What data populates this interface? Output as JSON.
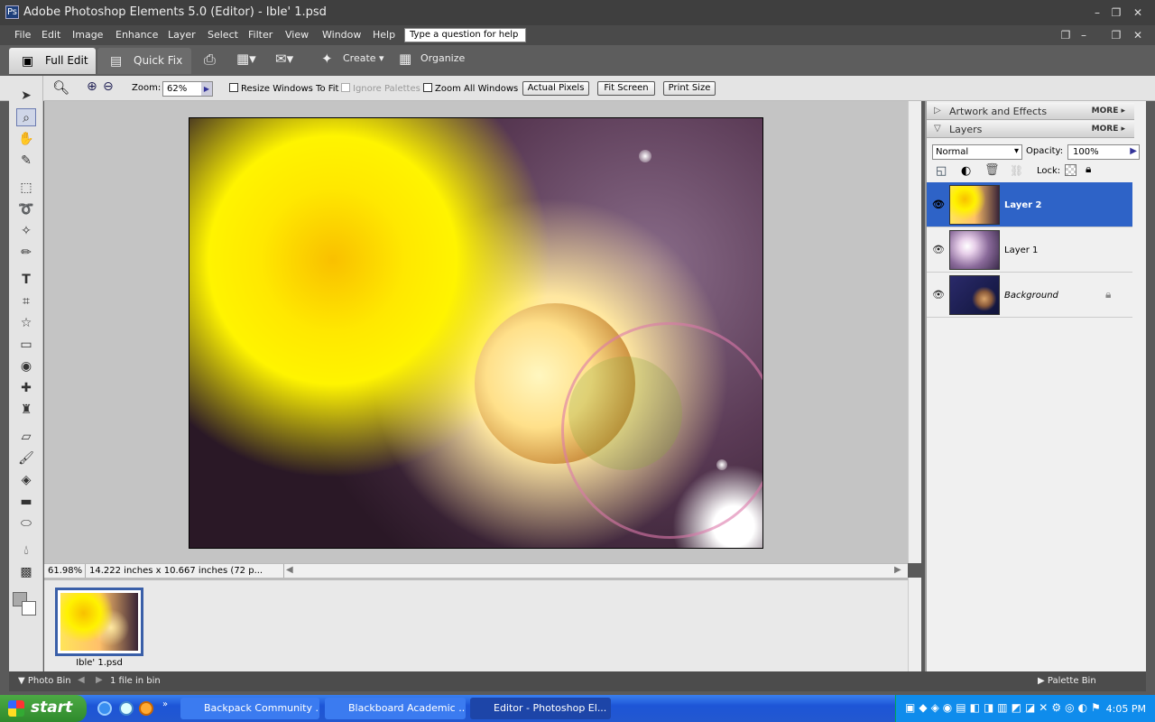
{
  "window": {
    "title": "Adobe Photoshop Elements 5.0 (Editor) - Ible' 1.psd"
  },
  "menu": {
    "items": [
      "File",
      "Edit",
      "Image",
      "Enhance",
      "Layer",
      "Select",
      "Filter",
      "View",
      "Window",
      "Help"
    ],
    "help_placeholder": "Type a question for help"
  },
  "modes": {
    "full_edit": "Full Edit",
    "quick_fix": "Quick Fix",
    "create": "Create",
    "organize": "Organize"
  },
  "options": {
    "zoom_label": "Zoom:",
    "zoom_value": "62%",
    "resize_windows": "Resize Windows To Fit",
    "ignore_palettes": "Ignore Palettes",
    "zoom_all": "Zoom All Windows",
    "actual_pixels": "Actual Pixels",
    "fit_screen": "Fit Screen",
    "print_size": "Print Size"
  },
  "status": {
    "zoom_pct": "61.98%",
    "doc_size": "14.222 inches x 10.667 inches (72 p..."
  },
  "photo_bin": {
    "thumb_label": "Ible' 1.psd",
    "label": "Photo Bin",
    "count": "1 file in bin"
  },
  "palette_bin": {
    "label": "Palette Bin"
  },
  "palette": {
    "artwork_title": "Artwork and Effects",
    "layers_title": "Layers",
    "more": "MORE",
    "blend_mode": "Normal",
    "opacity_label": "Opacity:",
    "opacity_value": "100%",
    "lock_label": "Lock:",
    "layers": [
      {
        "name": "Layer 2",
        "selected": true
      },
      {
        "name": "Layer 1",
        "selected": false
      },
      {
        "name": "Background",
        "selected": false,
        "locked": true
      }
    ]
  },
  "taskbar": {
    "start": "start",
    "tasks": [
      "Backpack Community ...",
      "Blackboard Academic ...",
      "Editor - Photoshop El..."
    ],
    "clock": "4:05 PM"
  },
  "colors": {
    "selection": "#2e63c7",
    "taskbar": "#2358d0",
    "start": "#2f8a2c"
  }
}
